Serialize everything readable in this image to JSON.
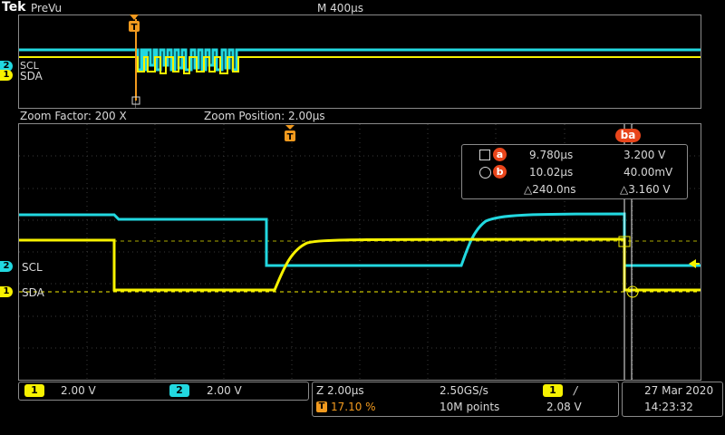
{
  "header": {
    "brand": "Tek",
    "mode": "PreVu",
    "timebase": "M 400µs"
  },
  "zoom_bar": {
    "factor": "Zoom Factor: 200 X",
    "position": "Zoom Position: 2.00µs"
  },
  "channels": [
    {
      "number": "1",
      "name": "SDA",
      "scale": "2.00 V",
      "color": "#f7f200"
    },
    {
      "number": "2",
      "name": "SCL",
      "scale": "2.00 V",
      "color": "#22d8e0"
    }
  ],
  "trigger_marker": "T",
  "cursors": {
    "label": "ba",
    "a": {
      "name": "a",
      "time": "9.780µs",
      "value": "3.200 V"
    },
    "b": {
      "name": "b",
      "time": "10.02µs",
      "value": "40.00mV"
    },
    "delta_time": "△240.0ns",
    "delta_value": "△3.160 V"
  },
  "acquisition": {
    "zoom_scale": "Z 2.00µs",
    "trigger_position": "17.10 %",
    "sample_rate": "2.50GS/s",
    "record_length": "10M points",
    "trigger_channel": "1",
    "trigger_slope": "/",
    "trigger_level": "2.08 V"
  },
  "datetime": {
    "date": "27 Mar  2020",
    "time": "14:23:32"
  },
  "colors": {
    "sda": "#f7f200",
    "scl": "#22d8e0",
    "trigger": "#f29a1e",
    "cursor_badge": "#e8451b",
    "grid": "#3a3a3a"
  }
}
